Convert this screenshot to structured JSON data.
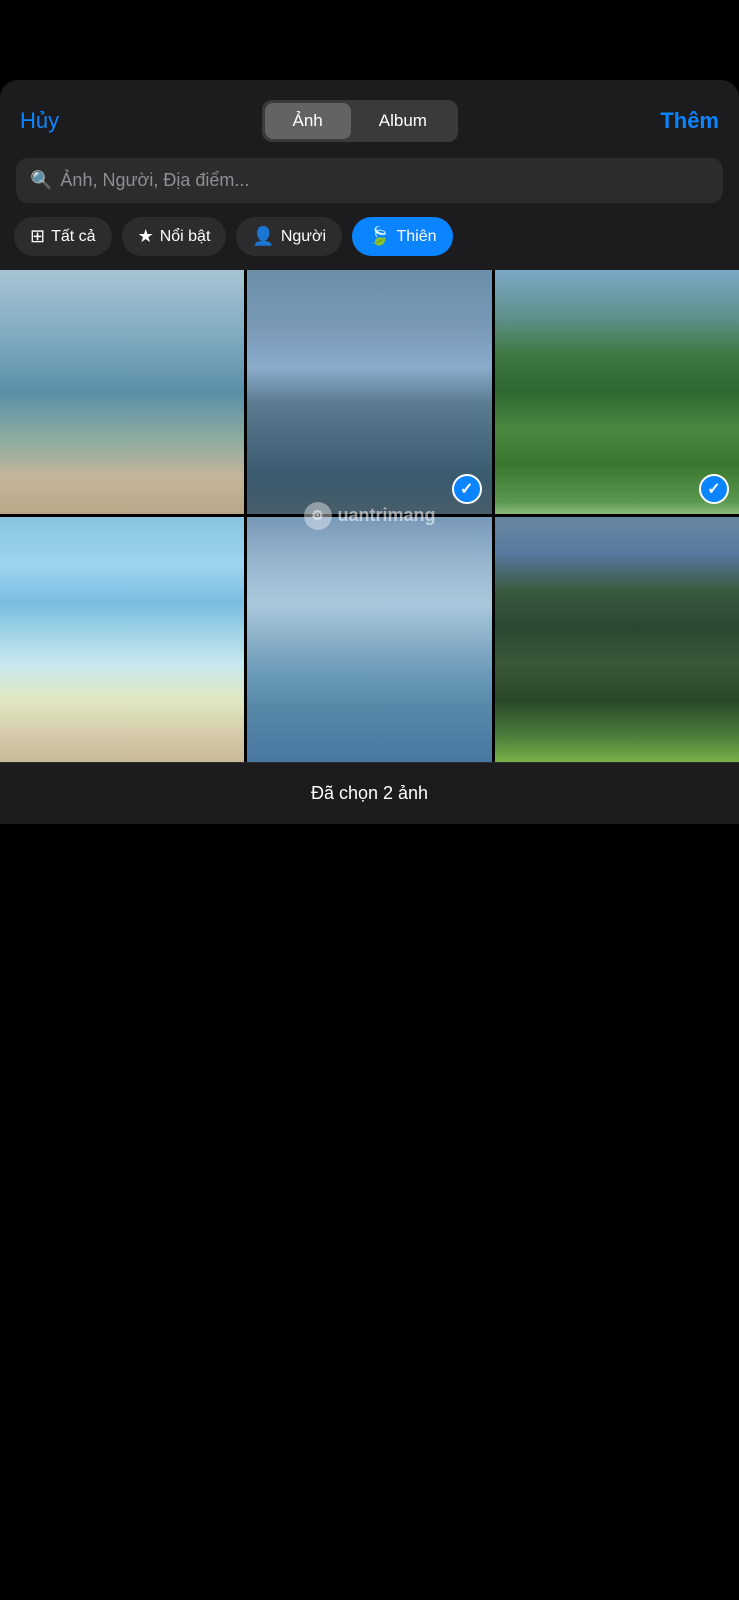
{
  "header": {
    "cancel_label": "Hủy",
    "add_label": "Thêm",
    "segment": {
      "photo_label": "Ảnh",
      "album_label": "Album",
      "active": "photo"
    }
  },
  "search": {
    "placeholder": "Ảnh, Người, Địa điểm..."
  },
  "filter_tabs": [
    {
      "id": "all",
      "label": "Tất cả",
      "icon": "grid",
      "active": false
    },
    {
      "id": "featured",
      "label": "Nổi bật",
      "icon": "star",
      "active": false
    },
    {
      "id": "people",
      "label": "Người",
      "icon": "person",
      "active": false
    },
    {
      "id": "nature",
      "label": "Thiên",
      "icon": "leaf",
      "active": true
    }
  ],
  "photos": [
    {
      "id": 1,
      "type": "beach-person",
      "selected": false
    },
    {
      "id": 2,
      "type": "sea-cloudy",
      "selected": true
    },
    {
      "id": 3,
      "type": "mountain-forest",
      "selected": true
    },
    {
      "id": 4,
      "type": "beach-clear",
      "selected": false
    },
    {
      "id": 5,
      "type": "sea-boat",
      "selected": false
    },
    {
      "id": 6,
      "type": "pine-forest",
      "selected": false
    }
  ],
  "watermark": {
    "text": "uantrimang",
    "icon": "⚙"
  },
  "bottom_bar": {
    "text": "Đã chọn 2 ảnh"
  },
  "icons": {
    "search": "🔍",
    "grid": "⊞",
    "star": "★",
    "person": "👤",
    "leaf": "🍃",
    "check": "✓"
  }
}
